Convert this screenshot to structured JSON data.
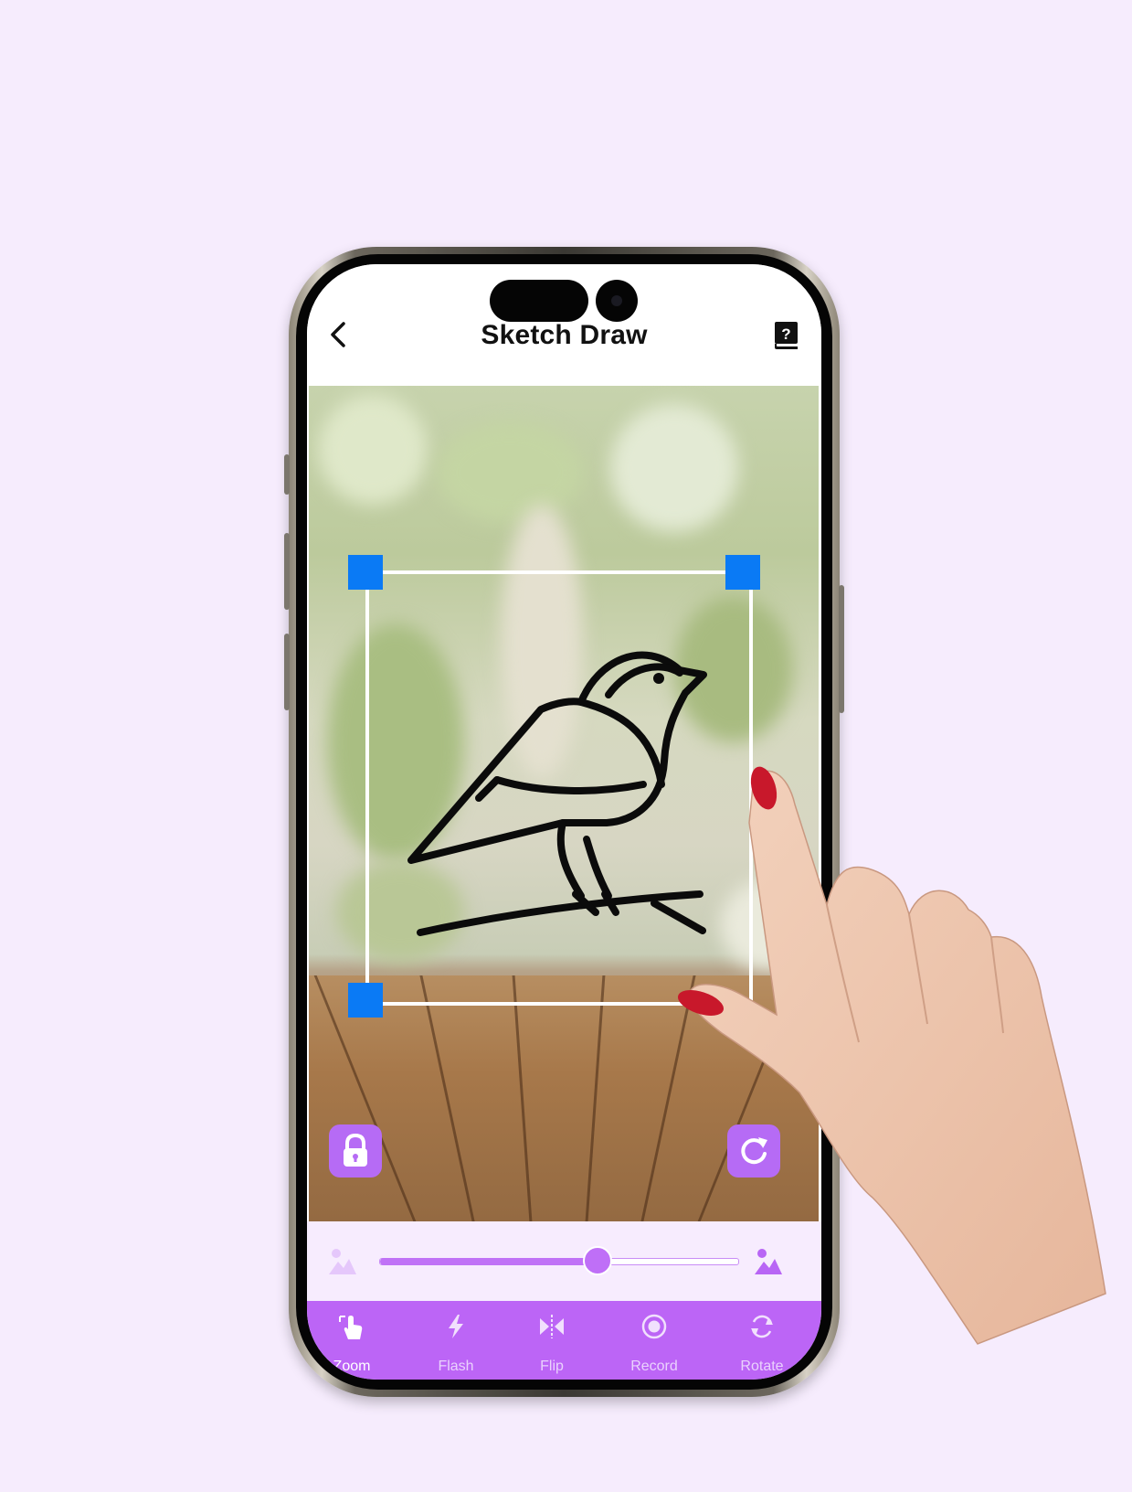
{
  "app": {
    "title": "Sketch Draw"
  },
  "header": {
    "back_icon": "chevron-left-icon",
    "help_icon": "help-book-icon"
  },
  "controls": {
    "lock_icon": "lock-icon",
    "reset_icon": "refresh-icon"
  },
  "opacity": {
    "value": 0.61,
    "low_icon": "image-faded-icon",
    "high_icon": "image-solid-icon"
  },
  "toolbar": {
    "items": [
      {
        "label": "Zoom",
        "icon": "hand-pointer-icon",
        "active": true
      },
      {
        "label": "Flash",
        "icon": "flash-icon",
        "active": false
      },
      {
        "label": "Flip",
        "icon": "flip-icon",
        "active": false
      },
      {
        "label": "Record",
        "icon": "record-icon",
        "active": false
      },
      {
        "label": "Rotate",
        "icon": "rotate-icon",
        "active": false
      }
    ]
  },
  "colors": {
    "accent": "#bc65f6",
    "background": "#f6ecfd",
    "handle": "#0a7af5"
  }
}
